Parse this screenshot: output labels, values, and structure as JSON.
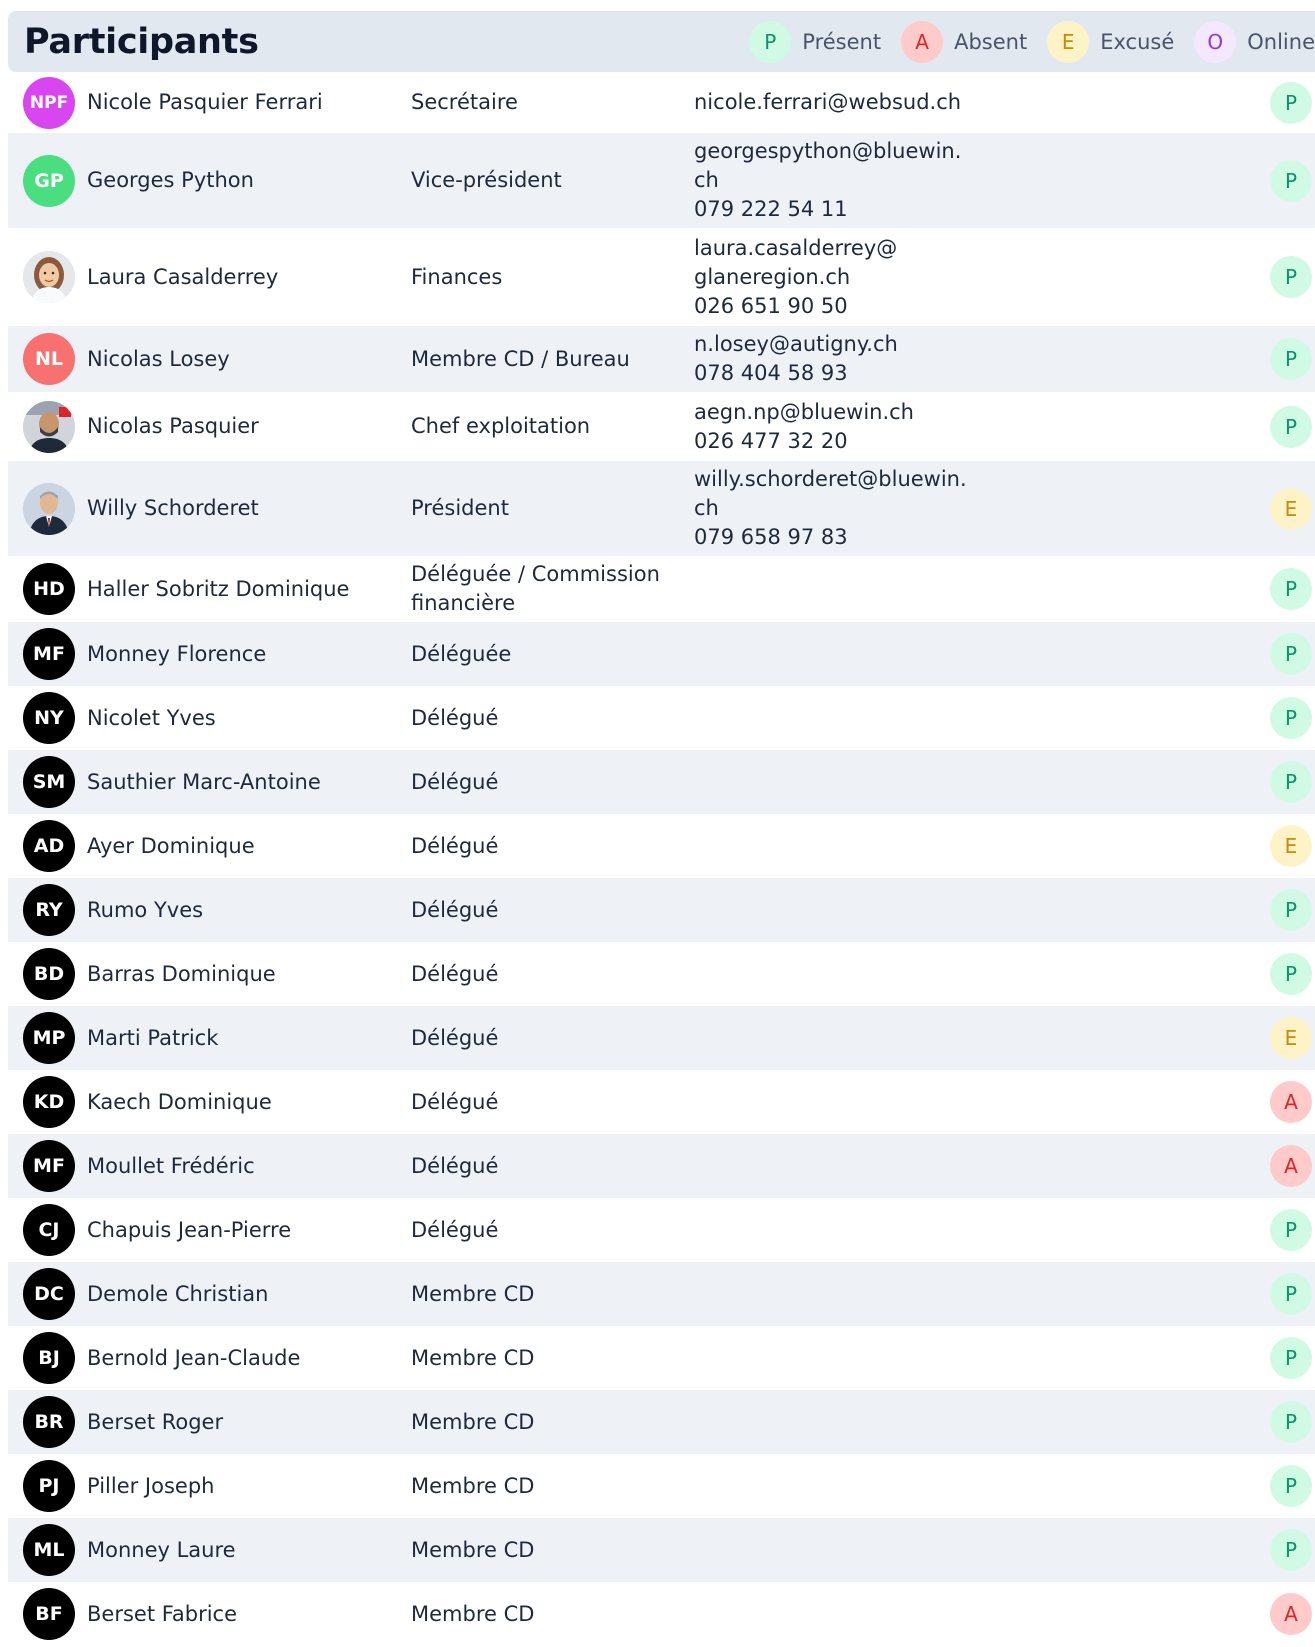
{
  "title": "Participants",
  "legend": [
    {
      "code": "P",
      "label": "Présent"
    },
    {
      "code": "A",
      "label": "Absent"
    },
    {
      "code": "E",
      "label": "Excusé"
    },
    {
      "code": "O",
      "label": "Online"
    }
  ],
  "participants": [
    {
      "initials": "NPF",
      "avatar_color": "#d946ef",
      "name": "Nicole Pasquier Ferrari",
      "role": [
        "Secrétaire"
      ],
      "contact": [
        "nicole.ferrari@websud.ch"
      ],
      "status": "P"
    },
    {
      "initials": "GP",
      "avatar_color": "#4ade80",
      "name": "Georges Python",
      "role": [
        "Vice-président"
      ],
      "contact": [
        "georgespython@bluewin.",
        "ch",
        "079 222 54 11"
      ],
      "status": "P"
    },
    {
      "photo": "woman-portrait",
      "name": "Laura Casalderrey",
      "role": [
        "Finances"
      ],
      "contact": [
        "laura.casalderrey@",
        "glaneregion.ch",
        "026 651 90 50"
      ],
      "status": "P"
    },
    {
      "initials": "NL",
      "avatar_color": "#f87171",
      "name": "Nicolas Losey",
      "role": [
        "Membre CD / Bureau"
      ],
      "contact": [
        "n.losey@autigny.ch",
        "078 404 58 93"
      ],
      "status": "P"
    },
    {
      "photo": "man-portrait",
      "name": "Nicolas Pasquier",
      "role": [
        "Chef exploitation"
      ],
      "contact": [
        "aegn.np@bluewin.ch",
        "026 477 32 20"
      ],
      "status": "P"
    },
    {
      "photo": "man-suit-portrait",
      "name": "Willy Schorderet",
      "role": [
        "Président"
      ],
      "contact": [
        "willy.schorderet@bluewin.",
        "ch",
        "079 658 97 83"
      ],
      "status": "E"
    },
    {
      "initials": "HD",
      "avatar_color": "#000000",
      "name": "Haller Sobritz Dominique",
      "role": [
        "Déléguée / Commission",
        "financière"
      ],
      "contact": [],
      "status": "P"
    },
    {
      "initials": "MF",
      "avatar_color": "#000000",
      "name": "Monney Florence",
      "role": [
        "Déléguée"
      ],
      "contact": [],
      "status": "P"
    },
    {
      "initials": "NY",
      "avatar_color": "#000000",
      "name": "Nicolet Yves",
      "role": [
        "Délégué"
      ],
      "contact": [],
      "status": "P"
    },
    {
      "initials": "SM",
      "avatar_color": "#000000",
      "name": "Sauthier Marc-Antoine",
      "role": [
        "Délégué"
      ],
      "contact": [],
      "status": "P"
    },
    {
      "initials": "AD",
      "avatar_color": "#000000",
      "name": "Ayer Dominique",
      "role": [
        "Délégué"
      ],
      "contact": [],
      "status": "E"
    },
    {
      "initials": "RY",
      "avatar_color": "#000000",
      "name": "Rumo Yves",
      "role": [
        "Délégué"
      ],
      "contact": [],
      "status": "P"
    },
    {
      "initials": "BD",
      "avatar_color": "#000000",
      "name": "Barras Dominique",
      "role": [
        "Délégué"
      ],
      "contact": [],
      "status": "P"
    },
    {
      "initials": "MP",
      "avatar_color": "#000000",
      "name": "Marti Patrick",
      "role": [
        "Délégué"
      ],
      "contact": [],
      "status": "E"
    },
    {
      "initials": "KD",
      "avatar_color": "#000000",
      "name": "Kaech Dominique",
      "role": [
        "Délégué"
      ],
      "contact": [],
      "status": "A"
    },
    {
      "initials": "MF",
      "avatar_color": "#000000",
      "name": "Moullet Frédéric",
      "role": [
        "Délégué"
      ],
      "contact": [],
      "status": "A"
    },
    {
      "initials": "CJ",
      "avatar_color": "#000000",
      "name": "Chapuis Jean-Pierre",
      "role": [
        "Délégué"
      ],
      "contact": [],
      "status": "P"
    },
    {
      "initials": "DC",
      "avatar_color": "#000000",
      "name": "Demole Christian",
      "role": [
        "Membre CD"
      ],
      "contact": [],
      "status": "P"
    },
    {
      "initials": "BJ",
      "avatar_color": "#000000",
      "name": "Bernold Jean-Claude",
      "role": [
        "Membre CD"
      ],
      "contact": [],
      "status": "P"
    },
    {
      "initials": "BR",
      "avatar_color": "#000000",
      "name": "Berset Roger",
      "role": [
        "Membre CD"
      ],
      "contact": [],
      "status": "P"
    },
    {
      "initials": "PJ",
      "avatar_color": "#000000",
      "name": "Piller Joseph",
      "role": [
        "Membre CD"
      ],
      "contact": [],
      "status": "P"
    },
    {
      "initials": "ML",
      "avatar_color": "#000000",
      "name": "Monney Laure",
      "role": [
        "Membre CD"
      ],
      "contact": [],
      "status": "P"
    },
    {
      "initials": "BF",
      "avatar_color": "#000000",
      "name": "Berset Fabrice",
      "role": [
        "Membre CD"
      ],
      "contact": [],
      "status": "A"
    }
  ]
}
